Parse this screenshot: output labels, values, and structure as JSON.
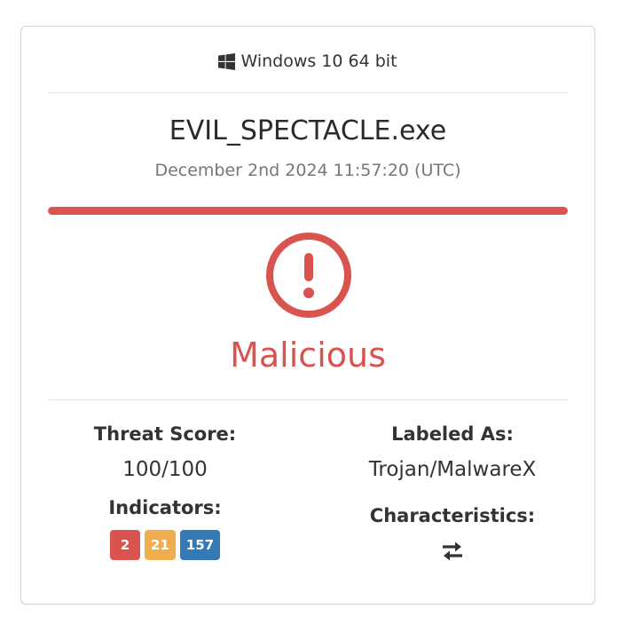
{
  "os": {
    "icon": "windows-icon",
    "label": "Windows 10 64 bit"
  },
  "file": {
    "name": "EVIL_SPECTACLE.exe",
    "date": "December 2nd 2024 11:57:20 (UTC)"
  },
  "verdict": {
    "icon": "exclamation-circle-icon",
    "label": "Malicious",
    "color": "#d9534f",
    "threat_bar_level": 1.0
  },
  "threat_score": {
    "title": "Threat Score:",
    "value": "100/100"
  },
  "labeled_as": {
    "title": "Labeled As:",
    "value": "Trojan/MalwareX"
  },
  "indicators": {
    "title": "Indicators:",
    "badges": [
      {
        "count": "2",
        "color": "#d9534f",
        "severity": "malicious"
      },
      {
        "count": "21",
        "color": "#f0ad4e",
        "severity": "suspicious"
      },
      {
        "count": "157",
        "color": "#337ab7",
        "severity": "informative"
      }
    ]
  },
  "characteristics": {
    "title": "Characteristics:",
    "icon": "exchange-arrows-icon"
  }
}
